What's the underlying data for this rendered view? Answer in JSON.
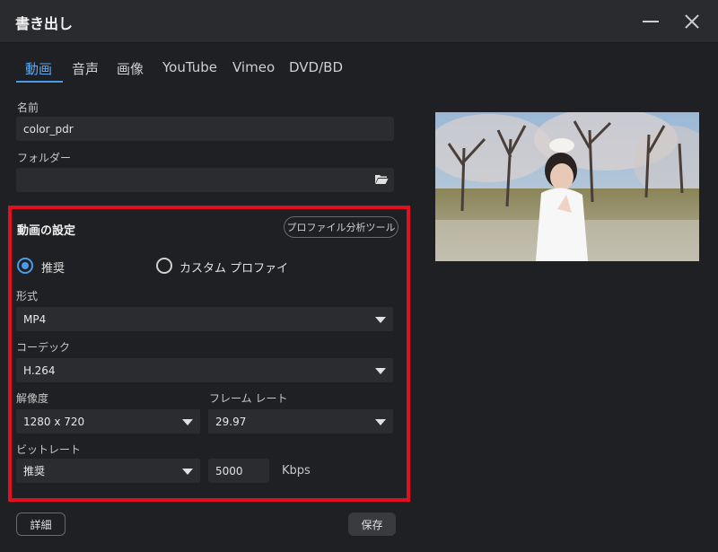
{
  "window": {
    "title": "書き出し",
    "minimize_icon": "minimize-icon",
    "close_icon": "close-icon"
  },
  "tabs": [
    "動画",
    "音声",
    "画像",
    "YouTube",
    "Vimeo",
    "DVD/BD"
  ],
  "active_tab": "動画",
  "name": {
    "label": "名前",
    "value": "color_pdr"
  },
  "folder": {
    "label": "フォルダー",
    "value": "",
    "icon": "folder-open-icon"
  },
  "video_settings": {
    "title": "動画の設定",
    "profile_tool_button": "プロファイル分析ツール",
    "radio_recommended": "推奨",
    "radio_custom": "カスタム プロファイ",
    "selected_mode": "推奨",
    "format": {
      "label": "形式",
      "value": "MP4"
    },
    "codec": {
      "label": "コーデック",
      "value": "H.264"
    },
    "resolution": {
      "label": "解像度",
      "value": "1280 x 720"
    },
    "frame_rate": {
      "label": "フレーム レート",
      "value": "29.97"
    },
    "bitrate": {
      "label": "ビットレート",
      "mode": "推奨",
      "value": "5000",
      "unit": "Kbps"
    }
  },
  "buttons": {
    "details": "詳細",
    "save": "保存"
  },
  "colors": {
    "accent": "#4a9ae8",
    "highlight_border": "#e01020",
    "background": "#1f2023"
  }
}
